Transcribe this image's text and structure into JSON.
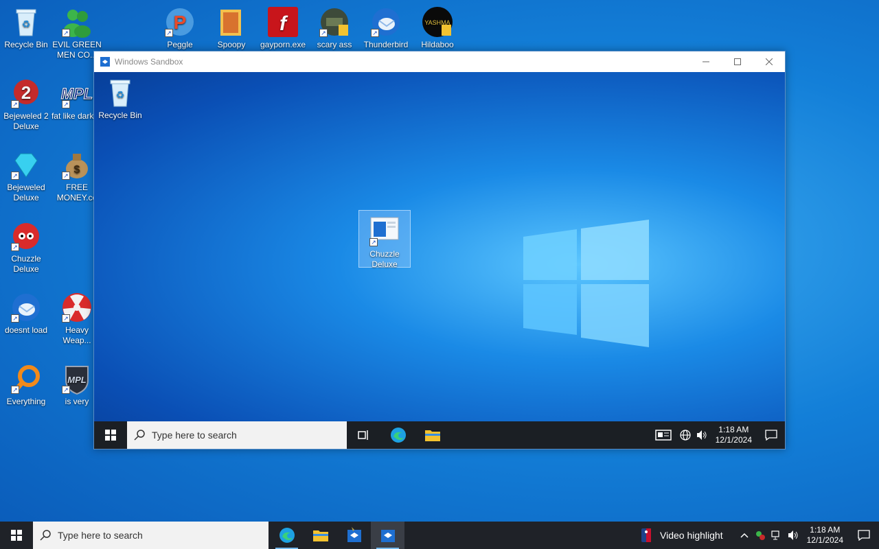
{
  "host_desktop_icons": [
    {
      "label": "Recycle Bin",
      "icon": "recycle-bin-icon"
    },
    {
      "label": "EVIL GREEN MEN CO...",
      "icon": "people-icon"
    },
    {
      "label": "Peggle",
      "icon": "peggle-icon"
    },
    {
      "label": "Spoopy",
      "icon": "folder-icon"
    },
    {
      "label": "gayporn.exe",
      "icon": "flash-icon"
    },
    {
      "label": "scary ass",
      "icon": "game-icon"
    },
    {
      "label": "Thunderbird",
      "icon": "thunderbird-icon"
    },
    {
      "label": "Hildaboo",
      "icon": "yashma-icon"
    },
    {
      "label": "Bejeweled 2 Deluxe",
      "icon": "bejeweled2-icon"
    },
    {
      "label": "fat like darkok",
      "icon": "mpl-icon"
    },
    {
      "label": "Bejeweled Deluxe",
      "icon": "gem-icon"
    },
    {
      "label": "FREE MONEY.co",
      "icon": "money-bag-icon"
    },
    {
      "label": "Chuzzle Deluxe",
      "icon": "chuzzle-icon"
    },
    {
      "label": "doesnt load",
      "icon": "thunderbird-icon"
    },
    {
      "label": "Heavy Weap...",
      "icon": "radiation-icon"
    },
    {
      "label": "Everything",
      "icon": "magnifier-icon"
    },
    {
      "label": "is very",
      "icon": "shield-icon"
    }
  ],
  "sandbox": {
    "title": "Windows Sandbox",
    "desktop_icons": [
      {
        "label": "Recycle Bin",
        "icon": "recycle-bin-icon"
      },
      {
        "label": "Chuzzle Deluxe",
        "icon": "app-window-icon",
        "selected": true
      }
    ],
    "taskbar": {
      "search_placeholder": "Type here to search",
      "clock_time": "1:18 AM",
      "clock_date": "12/1/2024"
    }
  },
  "host_taskbar": {
    "search_placeholder": "Type here to search",
    "news_label": "Video highlight",
    "clock_time": "1:18 AM",
    "clock_date": "12/1/2024"
  },
  "colors": {
    "taskbar": "#1f2228",
    "accent": "#76b9ed",
    "desktop": "#137fd8"
  }
}
